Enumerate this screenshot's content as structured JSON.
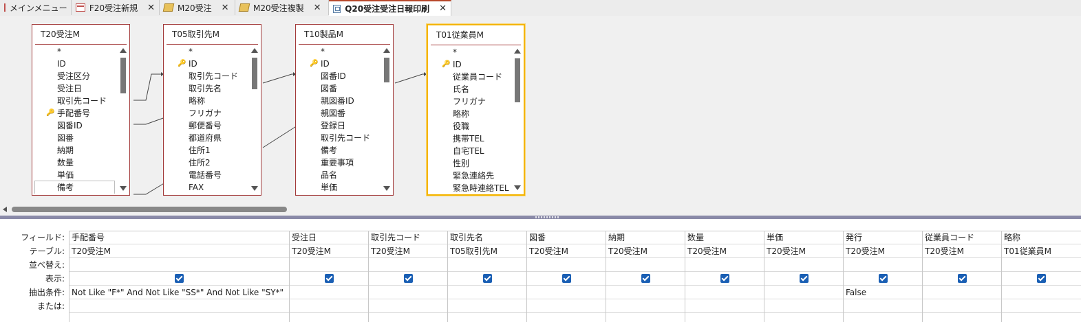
{
  "tabs": [
    {
      "label": "メインメニュー",
      "icon": "form-icon",
      "closable": false
    },
    {
      "label": "F20受注新規",
      "icon": "form-icon",
      "closable": true
    },
    {
      "label": "M20受注",
      "icon": "macro-icon",
      "closable": true
    },
    {
      "label": "M20受注複製",
      "icon": "macro-icon",
      "closable": true
    },
    {
      "label": "Q20受注受注日報印刷",
      "icon": "query-icon",
      "closable": true,
      "active": true
    }
  ],
  "close_glyph": "✕",
  "tables": [
    {
      "name": "T20受注M",
      "fields": [
        "*",
        "ID",
        "受注区分",
        "受注日",
        "取引先コード",
        "手配番号",
        "図番ID",
        "図番",
        "納期",
        "数量",
        "単価",
        "備考"
      ],
      "key_index": 5
    },
    {
      "name": "T05取引先M",
      "fields": [
        "*",
        "ID",
        "取引先コード",
        "取引先名",
        "略称",
        "フリガナ",
        "郵便番号",
        "都道府県",
        "住所1",
        "住所2",
        "電話番号",
        "FAX"
      ],
      "key_index": 1
    },
    {
      "name": "T10製品M",
      "fields": [
        "*",
        "ID",
        "図番ID",
        "図番",
        "親図番ID",
        "親図番",
        "登録日",
        "取引先コード",
        "備考",
        "重要事項",
        "品名",
        "単価"
      ],
      "key_index": 1
    },
    {
      "name": "T01従業員M",
      "fields": [
        "*",
        "ID",
        "従業員コード",
        "氏名",
        "フリガナ",
        "略称",
        "役職",
        "携帯TEL",
        "自宅TEL",
        "性別",
        "緊急連絡先",
        "緊急時連絡TEL"
      ],
      "key_index": 1
    }
  ],
  "grid": {
    "row_labels": [
      "フィールド:",
      "テーブル:",
      "並べ替え:",
      "表示:",
      "抽出条件:",
      "または:"
    ],
    "columns": [
      {
        "field": "手配番号",
        "table": "T20受注M",
        "sort": "",
        "show": true,
        "criteria": "Not Like \"F*\" And Not Like \"SS*\" And Not Like \"SY*\"",
        "or": ""
      },
      {
        "field": "受注日",
        "table": "T20受注M",
        "sort": "",
        "show": true,
        "criteria": "",
        "or": ""
      },
      {
        "field": "取引先コード",
        "table": "T20受注M",
        "sort": "",
        "show": true,
        "criteria": "",
        "or": ""
      },
      {
        "field": "取引先名",
        "table": "T05取引先M",
        "sort": "",
        "show": true,
        "criteria": "",
        "or": ""
      },
      {
        "field": "図番",
        "table": "T20受注M",
        "sort": "",
        "show": true,
        "criteria": "",
        "or": ""
      },
      {
        "field": "納期",
        "table": "T20受注M",
        "sort": "",
        "show": true,
        "criteria": "",
        "or": ""
      },
      {
        "field": "数量",
        "table": "T20受注M",
        "sort": "",
        "show": true,
        "criteria": "",
        "or": ""
      },
      {
        "field": "単価",
        "table": "T20受注M",
        "sort": "",
        "show": true,
        "criteria": "",
        "or": ""
      },
      {
        "field": "発行",
        "table": "T20受注M",
        "sort": "",
        "show": true,
        "criteria": "False",
        "or": ""
      },
      {
        "field": "従業員コード",
        "table": "T20受注M",
        "sort": "",
        "show": true,
        "criteria": "",
        "or": ""
      },
      {
        "field": "略称",
        "table": "T01従業員M",
        "sort": "",
        "show": true,
        "criteria": "",
        "or": ""
      }
    ]
  }
}
